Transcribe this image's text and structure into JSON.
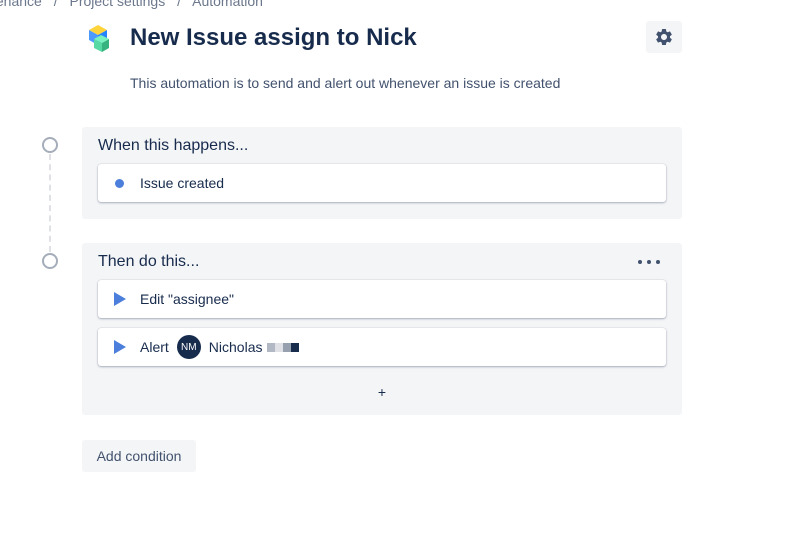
{
  "breadcrumb": [
    "tenance",
    "Project settings",
    "Automation"
  ],
  "rule": {
    "title": "New Issue assign to Nick",
    "description": "This automation is to send and alert out whenever an issue is created"
  },
  "trigger": {
    "heading": "When this happens...",
    "item": "Issue created"
  },
  "actions": {
    "heading": "Then do this...",
    "items": [
      {
        "label": "Edit \"assignee\""
      },
      {
        "label": "Alert",
        "user_initials": "NM",
        "user_name": "Nicholas"
      }
    ],
    "add_label": "+"
  },
  "add_condition_label": "Add condition",
  "colors": {
    "accent": "#4c7fdb",
    "avatar": "#172b4d",
    "panel": "#f4f5f7"
  },
  "icons": {
    "settings": "gear-icon",
    "more": "more-icon",
    "trigger_bullet": "dot-icon",
    "action": "play-icon"
  }
}
